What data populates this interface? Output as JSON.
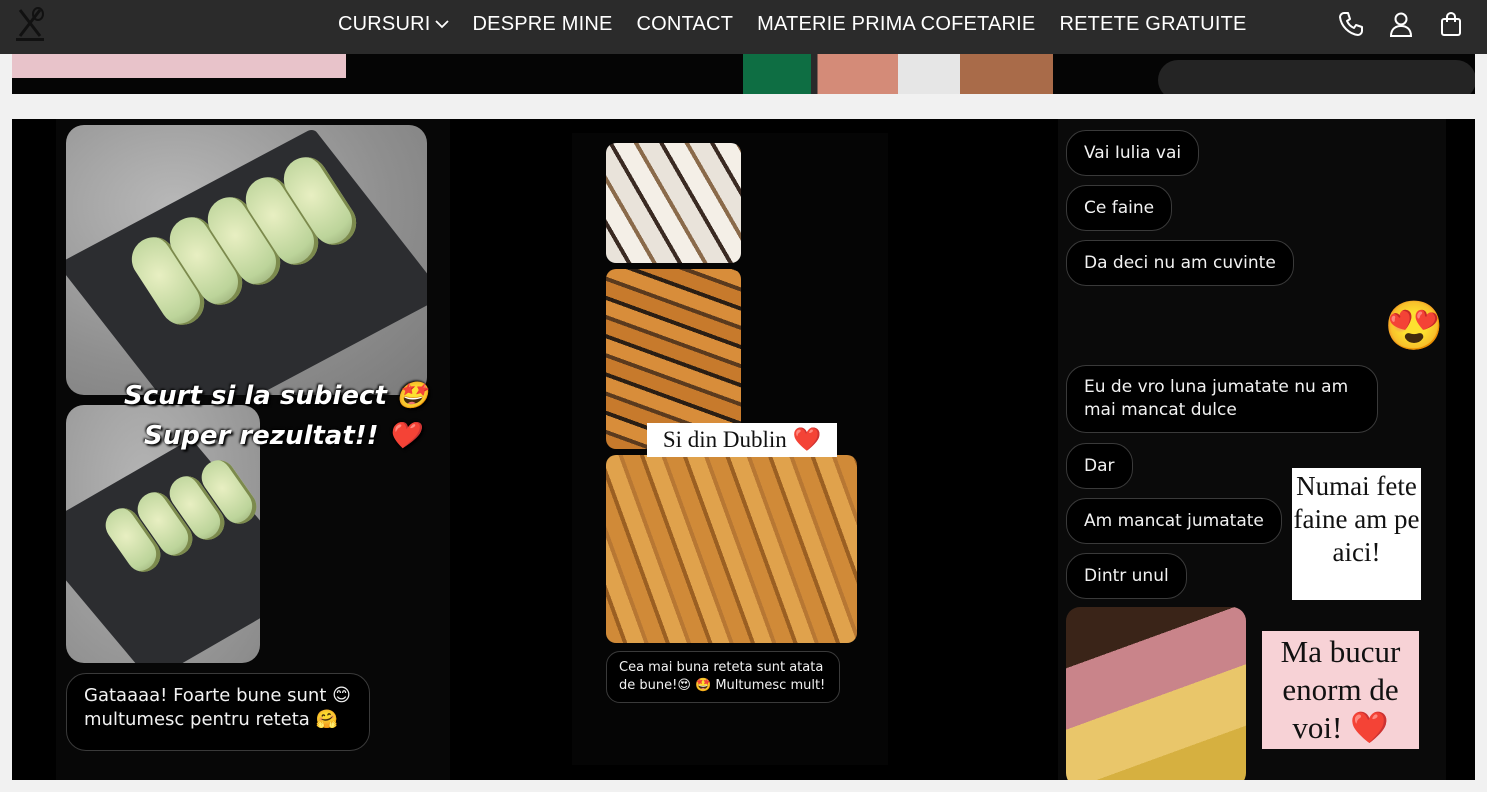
{
  "nav": {
    "logo_icon": "whisk-logo-icon",
    "menu": [
      {
        "label": "CURSURI",
        "has_dropdown": true
      },
      {
        "label": "DESPRE MINE"
      },
      {
        "label": "CONTACT"
      },
      {
        "label": "MATERIE PRIMA COFETARIE"
      },
      {
        "label": "RETETE GRATUITE"
      }
    ],
    "icons": [
      "phone-icon",
      "user-icon",
      "shopping-bag-icon"
    ]
  },
  "story1": {
    "line1": "Scurt si la subiect 🤩",
    "line2": "Super rezultat!! ❤️",
    "message": "Gataaaa! Foarte bune sunt 😊 multumesc pentru reteta 🤗"
  },
  "story2": {
    "caption": "Si din Dublin ❤️",
    "message": "Cea mai buna reteta sunt atata de bune!😍 🤩 Multumesc mult!"
  },
  "story3": {
    "messages": [
      "Vai Iulia vai",
      "Ce faine",
      "Da deci nu am cuvinte",
      "Eu de vro luna jumatate nu am mai mancat dulce",
      "Dar",
      "Am mancat jumatate",
      "Dintr unul"
    ],
    "emoji": "😍",
    "sticker1": "Numai fete faine am pe aici!",
    "sticker2": "Ma bucur enorm de voi! ❤️"
  },
  "colors": {
    "nav_bg": "#2b2b2b",
    "page_bg": "#f1f1f1",
    "panel_bg": "#000000",
    "sticker_pink": "#f7d2d6"
  }
}
